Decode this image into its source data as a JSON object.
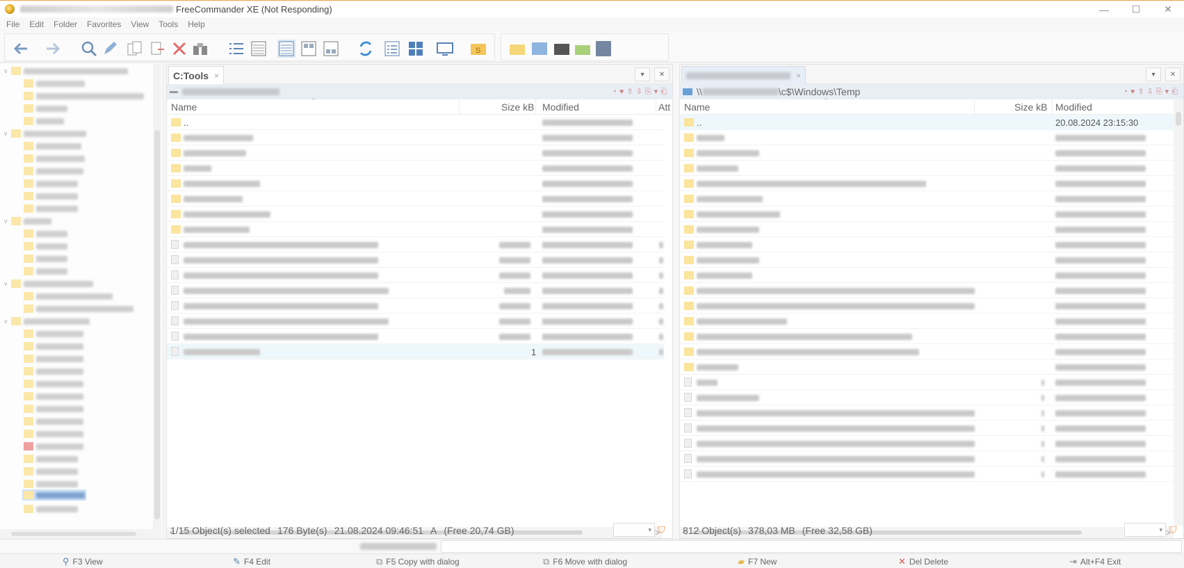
{
  "window": {
    "title": "FreeCommander XE (Not Responding)",
    "controls": [
      "—",
      "☐",
      "✕"
    ]
  },
  "menu": [
    "File",
    "Edit",
    "Folder",
    "Favorites",
    "View",
    "Tools",
    "Help"
  ],
  "left_panel": {
    "tab_label": "C:Tools",
    "tab_close": "×",
    "columns": [
      "Name",
      "Size kB",
      "Modified",
      "Att"
    ],
    "first_row": "..",
    "selected_size": "1",
    "status": {
      "objects": "1/15 Object(s) selected",
      "bytes": "176 Byte(s)",
      "datetime": "21.08.2024 09:46:51",
      "attr": "A",
      "free": "(Free 20,74 GB)"
    }
  },
  "right_panel": {
    "tab_close": "×",
    "path_prefix": "\\\\",
    "path_suffix": "\\c$\\Windows\\Temp",
    "columns": [
      "Name",
      "Size kB",
      "Modified"
    ],
    "first_row_name": "..",
    "first_row_modified": "20.08.2024 23:15:30",
    "status": {
      "objects": "812 Object(s)",
      "size": "378,03 MB",
      "free": "(Free 32,58 GB)"
    }
  },
  "fkeys": [
    {
      "icon": "search-icon",
      "label": "F3 View"
    },
    {
      "icon": "pencil-icon",
      "label": "F4 Edit"
    },
    {
      "icon": "copy-icon",
      "label": "F5 Copy with dialog"
    },
    {
      "icon": "move-icon",
      "label": "F6 Move with dialog"
    },
    {
      "icon": "folder-new-icon",
      "label": "F7 New"
    },
    {
      "icon": "delete-icon",
      "label": "Del Delete"
    },
    {
      "icon": "exit-icon",
      "label": "Alt+F4 Exit"
    }
  ],
  "colors": {
    "accent": "#f1a04a",
    "folder": "#fbe49c",
    "selection": "#eef8fc",
    "path_bar": "#e9eef5"
  }
}
